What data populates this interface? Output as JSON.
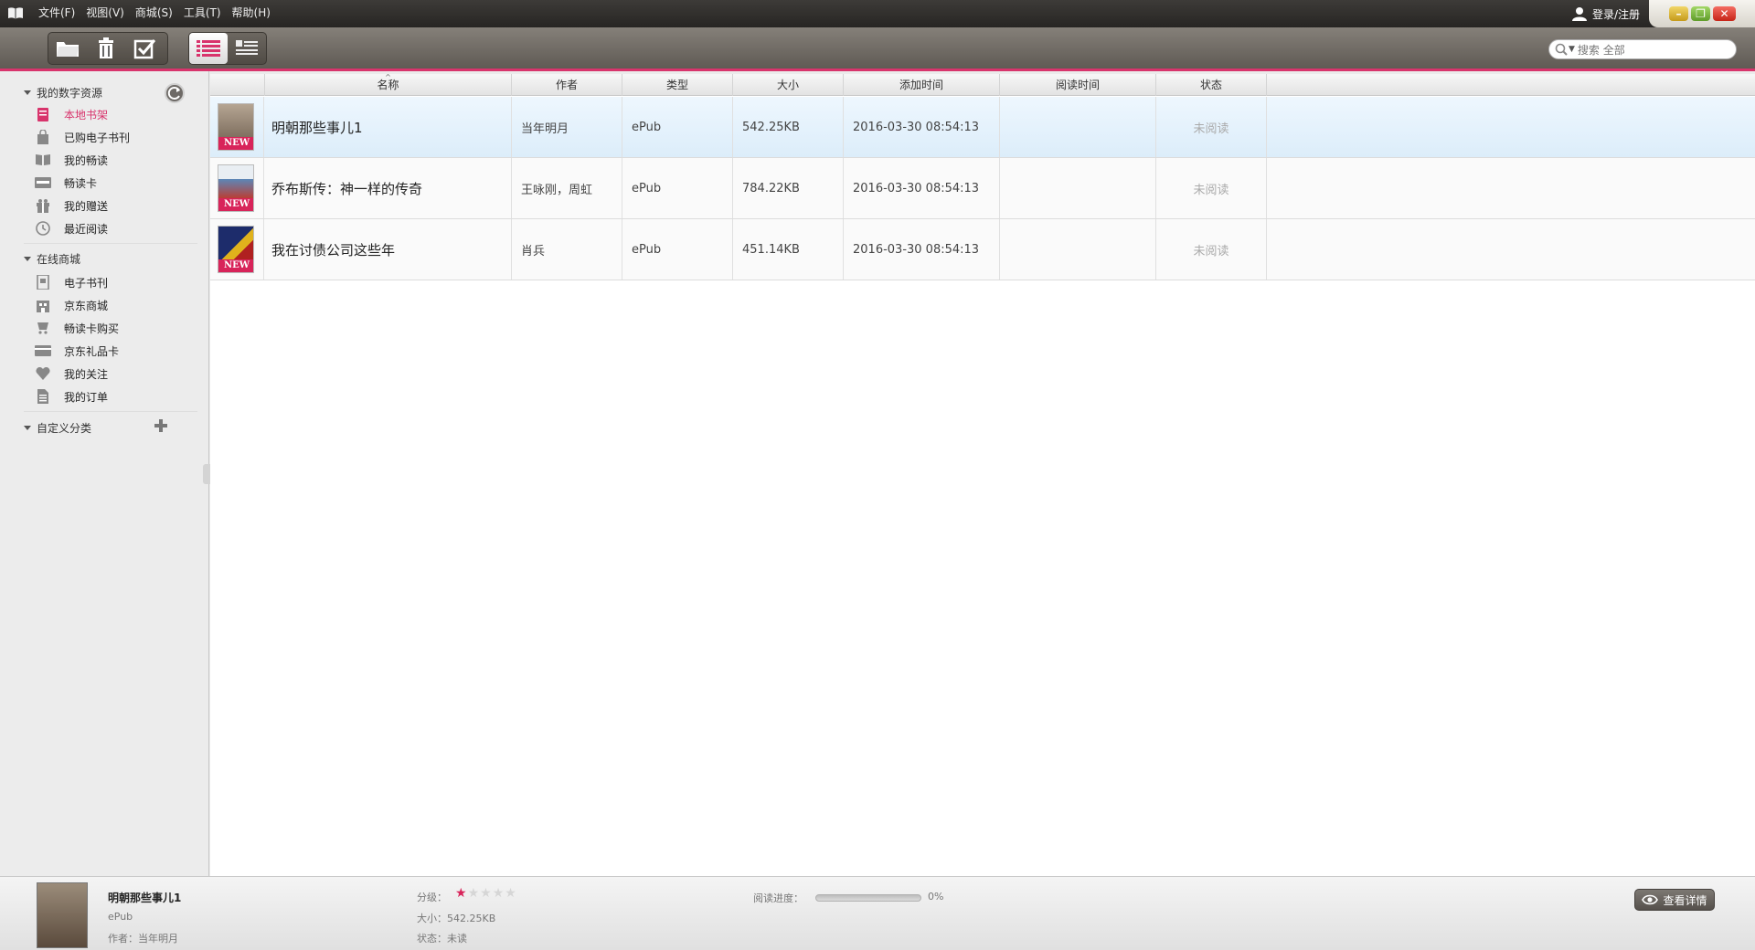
{
  "menu": {
    "items": [
      "文件(F)",
      "视图(V)",
      "商城(S)",
      "工具(T)",
      "帮助(H)"
    ],
    "login": "登录/注册"
  },
  "toolbar": {
    "search_placeholder": "搜索 全部",
    "accent": "#d8346c"
  },
  "sidebar": {
    "section1": "我的数字资源",
    "items1": [
      "本地书架",
      "已购电子书刊",
      "我的畅读",
      "畅读卡",
      "我的赠送",
      "最近阅读"
    ],
    "section2": "在线商城",
    "items2": [
      "电子书刊",
      "京东商城",
      "畅读卡购买",
      "京东礼品卡",
      "我的关注",
      "我的订单"
    ],
    "section3": "自定义分类"
  },
  "table": {
    "headers": [
      "名称",
      "作者",
      "类型",
      "大小",
      "添加时间",
      "阅读时间",
      "状态"
    ],
    "badge": "NEW",
    "rows": [
      {
        "name": "明朝那些事儿1",
        "author": "当年明月",
        "type": "ePub",
        "size": "542.25KB",
        "added": "2016-03-30 08:54:13",
        "read_time": "",
        "status": "未阅读"
      },
      {
        "name": "乔布斯传：神一样的传奇",
        "author": "王咏刚，周虹",
        "type": "ePub",
        "size": "784.22KB",
        "added": "2016-03-30 08:54:13",
        "read_time": "",
        "status": "未阅读"
      },
      {
        "name": "我在讨债公司这些年",
        "author": "肖兵",
        "type": "ePub",
        "size": "451.14KB",
        "added": "2016-03-30 08:54:13",
        "read_time": "",
        "status": "未阅读"
      }
    ]
  },
  "info": {
    "title": "明朝那些事儿1",
    "type": "ePub",
    "author": "作者：当年明月",
    "rating_label": "分级：",
    "rating": 1,
    "rating_max": 5,
    "size": "大小：542.25KB",
    "status": "状态：未读",
    "progress_label": "阅读进度：",
    "progress_value": 0,
    "progress_text": "0%",
    "details_button": "查看详情"
  }
}
